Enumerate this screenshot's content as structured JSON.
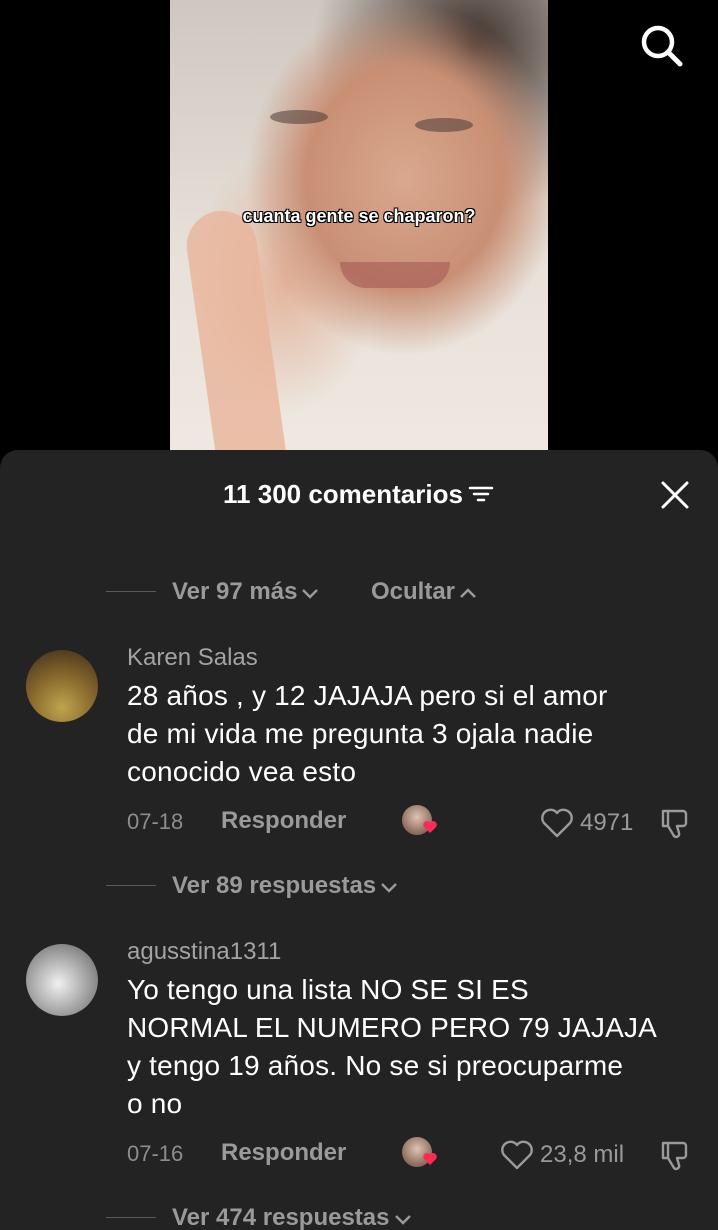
{
  "video": {
    "caption": "cuanta gente se chaparon?",
    "search_icon": "search-icon"
  },
  "sheet": {
    "title": "11 300 comentarios",
    "filter_icon": "filter-icon",
    "close_icon": "close-icon",
    "view_more": "Ver 97 más",
    "hide": "Ocultar"
  },
  "comments": [
    {
      "username": "Karen Salas",
      "text_line1": "28 años , y 12 JAJAJA pero si el amor",
      "text_line2": "de mi vida me pregunta 3 ojala nadie",
      "text_line3": "conocido vea esto",
      "date": "07-18",
      "reply_label": "Responder",
      "likes": "4971",
      "replies": "Ver 89 respuestas"
    },
    {
      "username": "agusstina1311",
      "text_line1": "Yo tengo una lista NO SE SI ES",
      "text_line2": "NORMAL EL NUMERO PERO 79 JAJAJA",
      "text_line3": "y tengo 19 años. No se si preocuparme",
      "text_line4": "o no",
      "date": "07-16",
      "reply_label": "Responder",
      "likes": "23,8 mil",
      "replies": "Ver 474 respuestas"
    }
  ],
  "colors": {
    "sheet_bg": "#232323",
    "liked_heart": "#fe2c55"
  }
}
